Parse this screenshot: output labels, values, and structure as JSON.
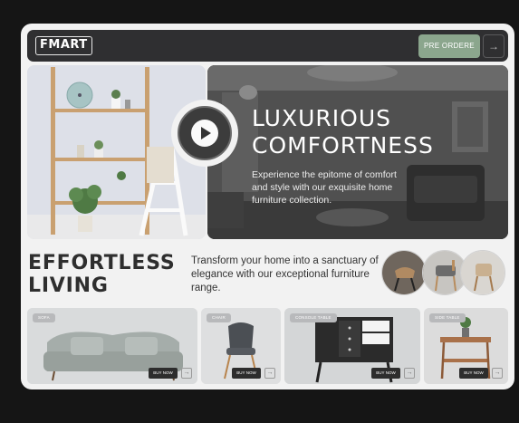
{
  "header": {
    "logo": "FMART",
    "preorder_label": "PRE ORDERE",
    "preorder_arrow": "→"
  },
  "hero": {
    "title_line1": "LUXURIOUS",
    "title_line2": "COMFORTNESS",
    "subtitle": "Experience the epitome of comfort and style with our exquisite home furniture collection."
  },
  "section": {
    "title_line1": "EFFORTLESS",
    "title_line2": "LIVING",
    "subtitle": "Transform your home into a sanctuary of elegance with our exceptional furniture range."
  },
  "products": [
    {
      "tag": "SOFA",
      "buy_label": "BUY NOW",
      "arrow": "→"
    },
    {
      "tag": "CHAIR",
      "buy_label": "BUY NOW",
      "arrow": "→"
    },
    {
      "tag": "CONSOLE TABLE",
      "buy_label": "BUY NOW",
      "arrow": "→"
    },
    {
      "tag": "SIDE TABLE",
      "buy_label": "BUY NOW",
      "arrow": "→"
    }
  ],
  "colors": {
    "accent": "#8ba68d",
    "dark": "#2f2f31",
    "background": "#151515"
  }
}
